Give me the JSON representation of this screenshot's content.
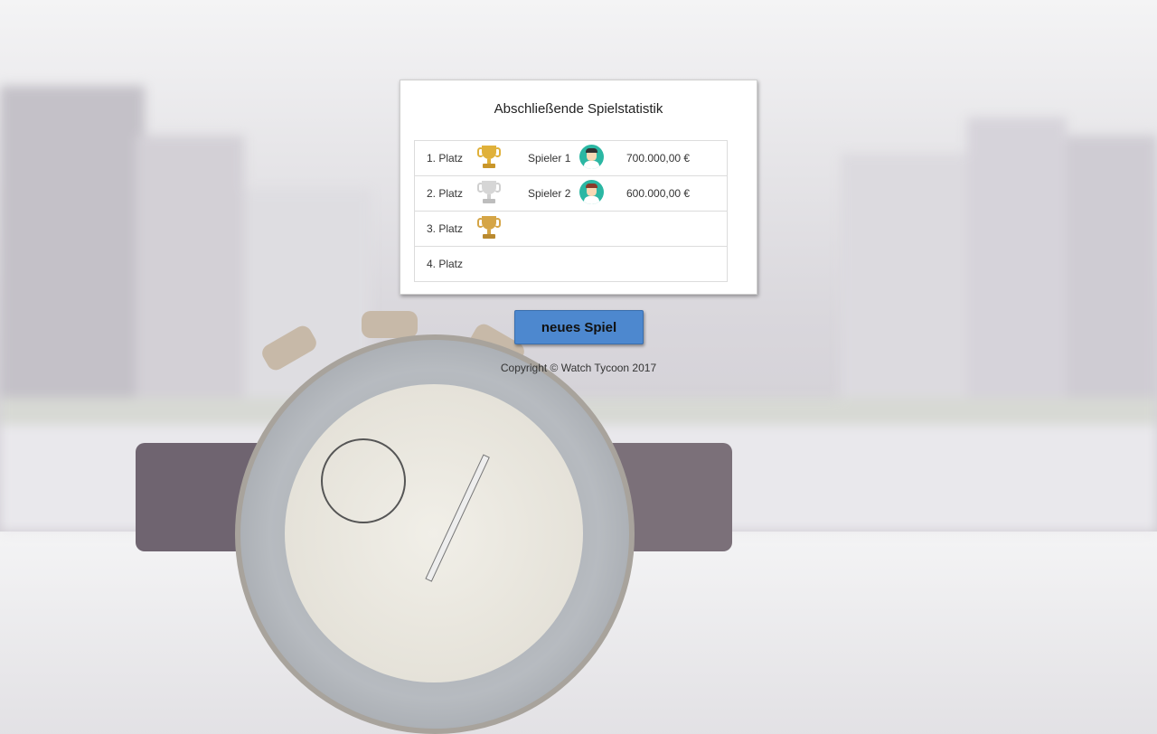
{
  "modal": {
    "title": "Abschließende Spielstatistik",
    "rows": [
      {
        "place": "1. Platz",
        "trophy": "gold-trophy-icon",
        "player": "Spieler 1",
        "avatar": "player-avatar-icon",
        "money": "700.000,00 €"
      },
      {
        "place": "2. Platz",
        "trophy": "silver-trophy-icon",
        "player": "Spieler 2",
        "avatar": "player-avatar-icon",
        "money": "600.000,00 €"
      },
      {
        "place": "3. Platz",
        "trophy": "bronze-trophy-icon",
        "player": "",
        "avatar": "",
        "money": ""
      },
      {
        "place": "4. Platz",
        "trophy": "",
        "player": "",
        "avatar": "",
        "money": ""
      }
    ]
  },
  "actions": {
    "new_game_label": "neues Spiel"
  },
  "footer": {
    "copyright": "Copyright © Watch Tycoon 2017"
  },
  "colors": {
    "gold": "#e0b13a",
    "silver": "#cfcfcf",
    "bronze": "#d5a546",
    "button": "#4d88cf",
    "avatar_bg": "#2bb7a3"
  }
}
